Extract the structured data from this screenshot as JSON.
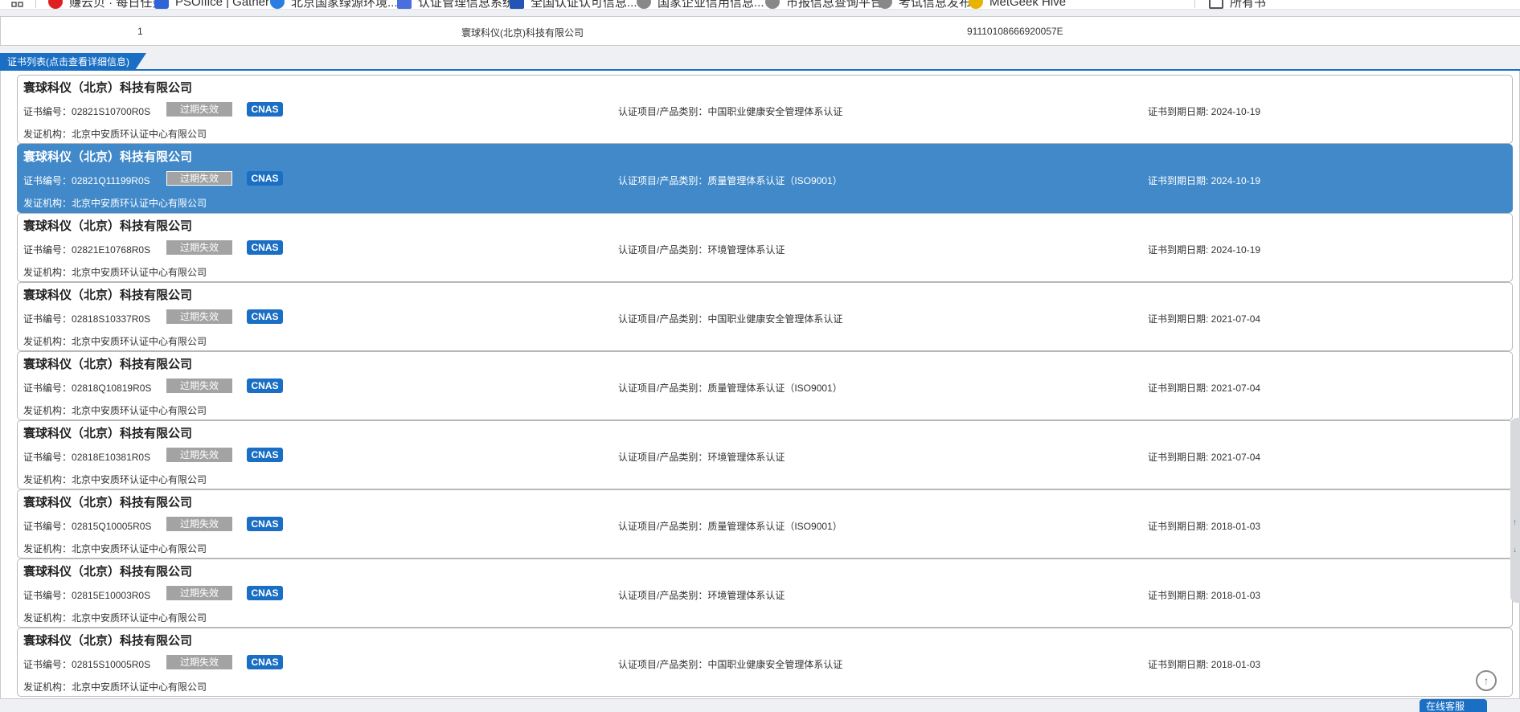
{
  "bookmarks": [
    {
      "label": "赚云贝 · 每日任务",
      "icon": "red-circle-icon",
      "color": "#e02020"
    },
    {
      "label": "PSOffice | Gather",
      "icon": "blue-square-icon",
      "color": "#2f64d8"
    },
    {
      "label": "北京国家绿源环境...",
      "icon": "blue-swirl-icon",
      "color": "#2a7de1"
    },
    {
      "label": "认证管理信息系统",
      "icon": "doc-icon",
      "color": "#4a6ee0"
    },
    {
      "label": "全国认证认可信息...",
      "icon": "square-icon",
      "color": "#2454b8"
    },
    {
      "label": "国家企业信用信息...",
      "icon": "globe-icon",
      "color": "#666666"
    },
    {
      "label": "市报信息查询平台",
      "icon": "globe-icon",
      "color": "#666666"
    },
    {
      "label": "考试信息发布",
      "icon": "globe-icon",
      "color": "#666666"
    },
    {
      "label": "MetGeek Hive",
      "icon": "yellow-icon",
      "color": "#e8b400"
    },
    {
      "label": "所有书",
      "icon": "folder-icon",
      "color": "#555555"
    }
  ],
  "top_row": {
    "index": "1",
    "company": "寰球科仪(北京)科技有限公司",
    "credit_code": "91110108666920057E"
  },
  "section_title": "证书列表(点击查看详细信息)",
  "labels": {
    "certno": "证书编号：",
    "issuer": "发证机构：",
    "category": "认证项目/产品类别：",
    "expiry": "证书到期日期: ",
    "expired_badge": "过期失效",
    "cnas_badge": "CNAS"
  },
  "certificates": [
    {
      "company": "寰球科仪（北京）科技有限公司",
      "certno": "02821S10700R0S",
      "category": "中国职业健康安全管理体系认证",
      "expiry": "2024-10-19",
      "issuer": "北京中安质环认证中心有限公司",
      "selected": false
    },
    {
      "company": "寰球科仪（北京）科技有限公司",
      "certno": "02821Q11199R0S",
      "category": "质量管理体系认证（ISO9001）",
      "expiry": "2024-10-19",
      "issuer": "北京中安质环认证中心有限公司",
      "selected": true
    },
    {
      "company": "寰球科仪（北京）科技有限公司",
      "certno": "02821E10768R0S",
      "category": "环境管理体系认证",
      "expiry": "2024-10-19",
      "issuer": "北京中安质环认证中心有限公司",
      "selected": false
    },
    {
      "company": "寰球科仪（北京）科技有限公司",
      "certno": "02818S10337R0S",
      "category": "中国职业健康安全管理体系认证",
      "expiry": "2021-07-04",
      "issuer": "北京中安质环认证中心有限公司",
      "selected": false
    },
    {
      "company": "寰球科仪（北京）科技有限公司",
      "certno": "02818Q10819R0S",
      "category": "质量管理体系认证（ISO9001）",
      "expiry": "2021-07-04",
      "issuer": "北京中安质环认证中心有限公司",
      "selected": false
    },
    {
      "company": "寰球科仪（北京）科技有限公司",
      "certno": "02818E10381R0S",
      "category": "环境管理体系认证",
      "expiry": "2021-07-04",
      "issuer": "北京中安质环认证中心有限公司",
      "selected": false
    },
    {
      "company": "寰球科仪（北京）科技有限公司",
      "certno": "02815Q10005R0S",
      "category": "质量管理体系认证（ISO9001）",
      "expiry": "2018-01-03",
      "issuer": "北京中安质环认证中心有限公司",
      "selected": false
    },
    {
      "company": "寰球科仪（北京）科技有限公司",
      "certno": "02815E10003R0S",
      "category": "环境管理体系认证",
      "expiry": "2018-01-03",
      "issuer": "北京中安质环认证中心有限公司",
      "selected": false
    },
    {
      "company": "寰球科仪（北京）科技有限公司",
      "certno": "02815S10005R0S",
      "category": "中国职业健康安全管理体系认证",
      "expiry": "2018-01-03",
      "issuer": "北京中安质环认证中心有限公司",
      "selected": false
    }
  ],
  "scroll_widget": {
    "up": "↑",
    "down": "↓"
  },
  "back_to_top_icon": "arrow-up-circle-icon",
  "back_to_top_glyph": "↑",
  "online_service": "在线客服",
  "colors": {
    "accent": "#1a6fc4",
    "selected_row": "#4189c9",
    "expired_badge": "#a3a3a3"
  }
}
